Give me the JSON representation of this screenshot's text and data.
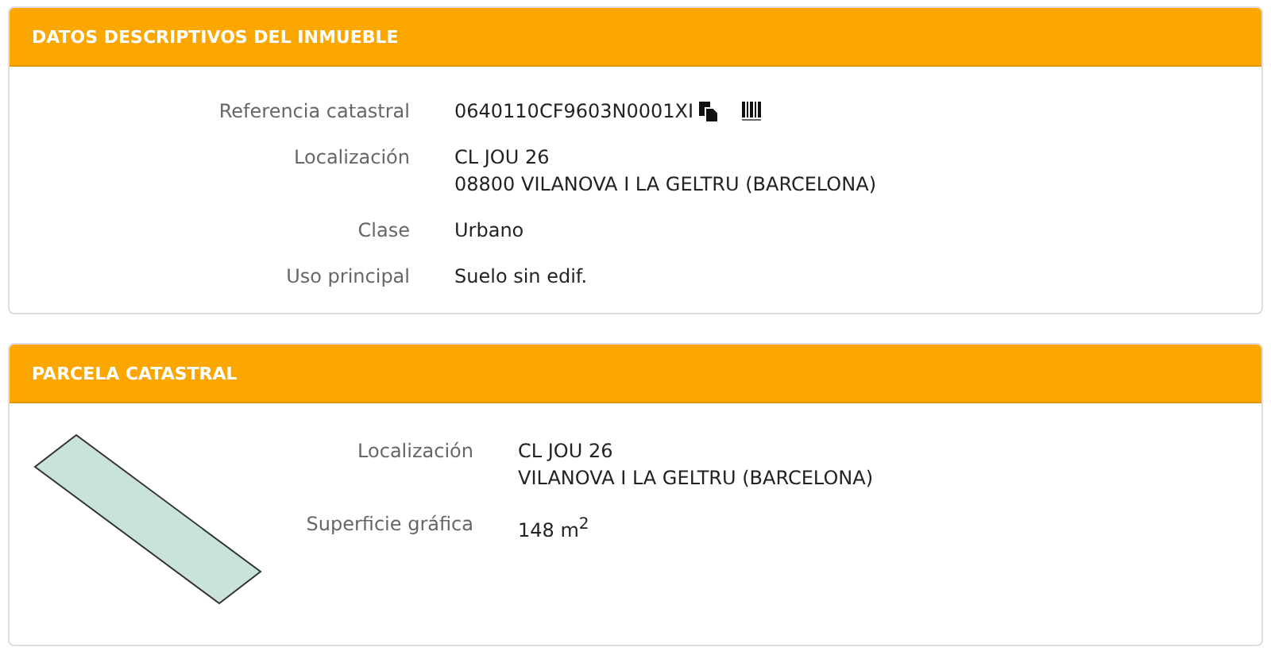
{
  "sections": [
    {
      "title": "DATOS DESCRIPTIVOS DEL INMUEBLE",
      "fields": [
        {
          "label": "Referencia catastral",
          "lines": [
            "0640110CF9603N0001XI"
          ],
          "actions": true
        },
        {
          "label": "Localización",
          "lines": [
            "CL JOU 26",
            "08800 VILANOVA I LA GELTRU (BARCELONA)"
          ]
        },
        {
          "label": "Clase",
          "lines": [
            "Urbano"
          ]
        },
        {
          "label": "Uso principal",
          "lines": [
            "Suelo sin edif."
          ]
        }
      ]
    },
    {
      "title": "PARCELA CATASTRAL",
      "plot": true,
      "fields": [
        {
          "label": "Localización",
          "lines": [
            "CL JOU 26",
            "VILANOVA I LA GELTRU (BARCELONA)"
          ]
        },
        {
          "label": "Superficie gráfica",
          "lines": [
            "148 m$^{2}$"
          ]
        }
      ]
    }
  ]
}
